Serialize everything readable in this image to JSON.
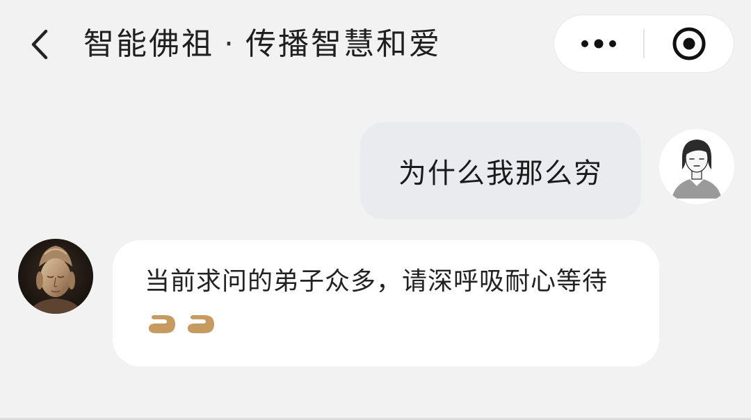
{
  "header": {
    "title_part1": "智能佛祖",
    "separator": "·",
    "title_part2": "传播智慧和爱",
    "back_icon": "chevron-left-icon",
    "more_icon": "more-dots-icon",
    "close_icon": "target-circle-icon"
  },
  "messages": [
    {
      "role": "user",
      "text": "为什么我那么穷",
      "avatar": "user-avatar-icon"
    },
    {
      "role": "bot",
      "text": "当前求问的弟子众多，请深呼吸耐心等待",
      "avatar": "buddha-avatar",
      "indicator": "typing-indicator"
    }
  ],
  "colors": {
    "background": "#f2f2f2",
    "user_bubble": "#e9ebef",
    "bot_bubble": "#ffffff",
    "typing_accent": "#c79a5f"
  }
}
